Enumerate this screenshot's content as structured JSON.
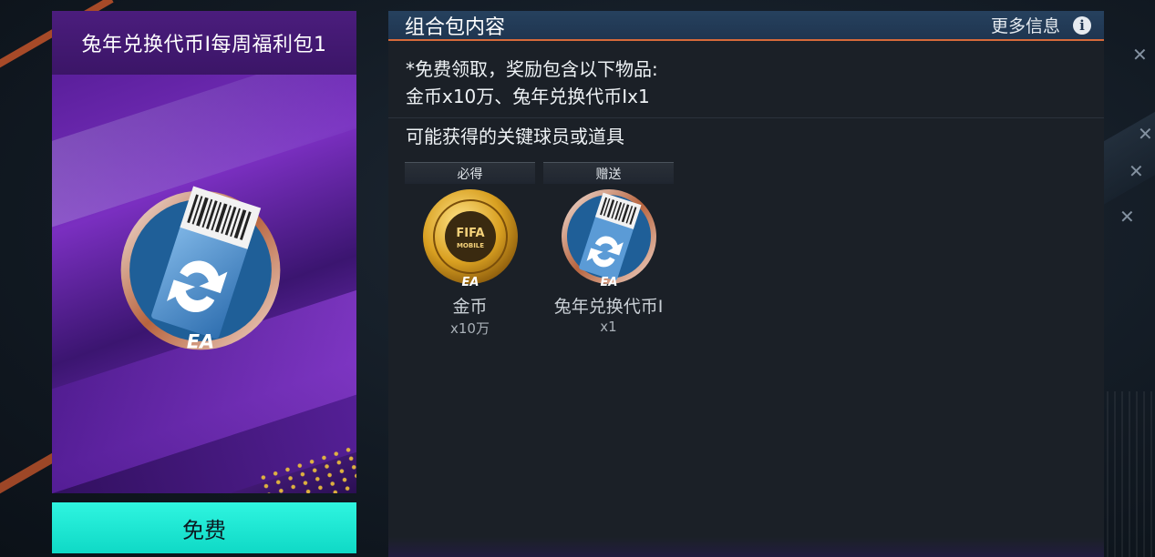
{
  "pack": {
    "title": "兔年兑换代币I每周福利包1",
    "button_label": "免费"
  },
  "contents": {
    "header_title": "组合包内容",
    "more_info_label": "更多信息",
    "info_icon_glyph": "i",
    "description_line1": "*免费领取，奖励包含以下物品:",
    "description_line2": "金币x10万、兔年兑换代币Ix1",
    "key_items_heading": "可能获得的关键球员或道具",
    "items": [
      {
        "tag": "必得",
        "name": "金币",
        "quantity": "x10万",
        "icon": "coin-icon"
      },
      {
        "tag": "赠送",
        "name": "兔年兑换代币I",
        "quantity": "x1",
        "icon": "exchange-token-icon"
      }
    ]
  },
  "colors": {
    "accent_orange": "#d6693a",
    "button_teal": "#1ee8d4",
    "pack_purple": "#4b1d7d"
  }
}
